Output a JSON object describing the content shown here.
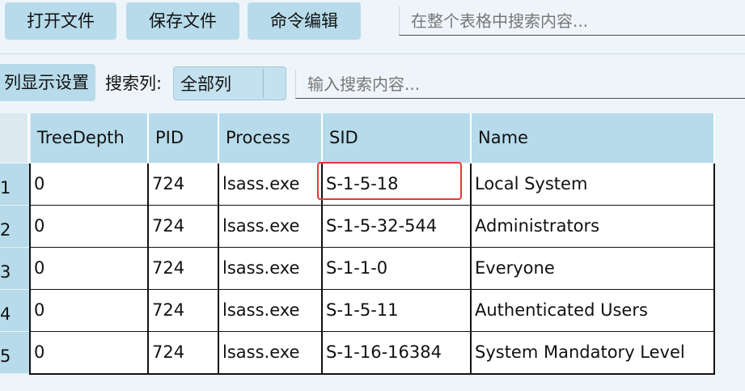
{
  "toolbar": {
    "open_file": "打开文件",
    "save_file": "保存文件",
    "command_edit": "命令编辑",
    "search_placeholder": "在整个表格中搜索内容..."
  },
  "filter": {
    "column_settings": "列显示设置",
    "search_column_label": "搜索列:",
    "search_column_value": "全部列",
    "search_placeholder": "输入搜索内容..."
  },
  "table": {
    "columns": [
      "TreeDepth",
      "PID",
      "Process",
      "SID",
      "Name"
    ],
    "rows": [
      {
        "index": "1",
        "cells": [
          "0",
          "724",
          "lsass.exe",
          "S-1-5-18",
          "Local System"
        ]
      },
      {
        "index": "2",
        "cells": [
          "0",
          "724",
          "lsass.exe",
          "S-1-5-32-544",
          "Administrators"
        ]
      },
      {
        "index": "3",
        "cells": [
          "0",
          "724",
          "lsass.exe",
          "S-1-1-0",
          "Everyone"
        ]
      },
      {
        "index": "4",
        "cells": [
          "0",
          "724",
          "lsass.exe",
          "S-1-5-11",
          "Authenticated Users"
        ]
      },
      {
        "index": "5",
        "cells": [
          "0",
          "724",
          "lsass.exe",
          "S-1-16-16384",
          "System Mandatory Level"
        ]
      }
    ]
  },
  "colors": {
    "accent": "#b7dbea",
    "highlight": "#e53935"
  }
}
